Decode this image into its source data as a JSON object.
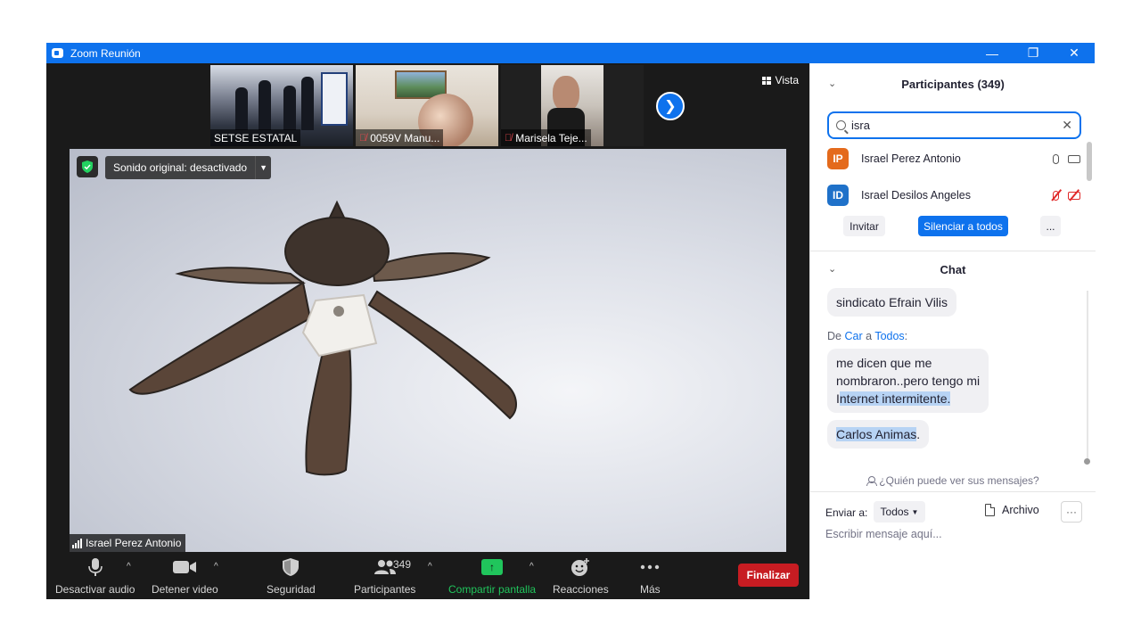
{
  "window": {
    "title": "Zoom Reunión",
    "minimize_glyph": "—",
    "restore_glyph": "❐",
    "close_glyph": "✕"
  },
  "thumbnails": [
    {
      "label": "SETSE ESTATAL",
      "muted": false
    },
    {
      "label": "0059V Manu...",
      "muted": true
    },
    {
      "label": "Marisela Teje...",
      "muted": true
    }
  ],
  "view": {
    "label": "Vista"
  },
  "main_video": {
    "sound_label": "Sonido original: desactivado",
    "speaker_name": "Israel Perez Antonio"
  },
  "toolbar": {
    "audio_label": "Desactivar audio",
    "video_label": "Detener video",
    "security_label": "Seguridad",
    "participants_label": "Participantes",
    "participants_count": "349",
    "share_label": "Compartir pantalla",
    "reactions_label": "Reacciones",
    "more_label": "Más",
    "end_label": "Finalizar"
  },
  "participants_panel": {
    "title": "Participantes (349)",
    "search_value": "isra",
    "items": [
      {
        "initials": "IP",
        "name": "Israel Perez Antonio",
        "avatar_color": "#e46a1c",
        "muted": false
      },
      {
        "initials": "ID",
        "name": "Israel Desilos Angeles",
        "avatar_color": "#1f71c9",
        "muted": true
      }
    ],
    "invite_label": "Invitar",
    "mute_all_label": "Silenciar a todos",
    "more_label": "..."
  },
  "chat": {
    "title": "Chat",
    "messages": {
      "first_bubble": "sindicato Efrain Vilis",
      "from_prefix": "De",
      "from_name": "Car",
      "to_word": "a",
      "to_name": "Todos",
      "second_line1": "me dicen que me",
      "second_line2": "nombraron..pero tengo mi",
      "second_line3_start": "I",
      "second_line3_highlight": "nternet intermitente.",
      "third_highlight": "Carlos Animas",
      "third_end": "."
    },
    "who_sees": "¿Quién puede ver sus mensajes?",
    "send_to_label": "Enviar a:",
    "send_to_value": "Todos",
    "file_label": "Archivo",
    "more_label": "···",
    "input_placeholder": "Escribir mensaje aquí..."
  },
  "colors": {
    "accent": "#0e72ed",
    "end_red": "#c71c22",
    "share_green": "#20c55c"
  }
}
